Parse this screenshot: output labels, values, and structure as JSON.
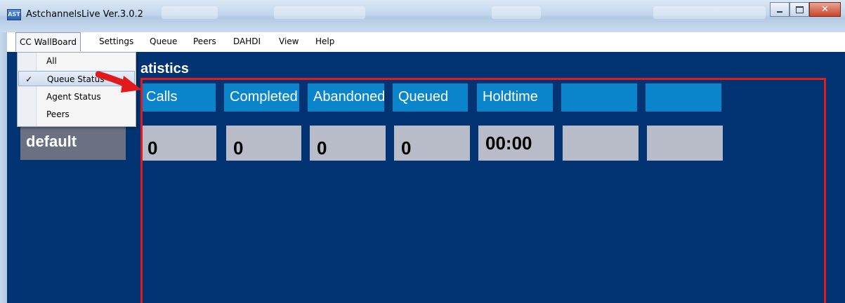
{
  "window": {
    "title": "AstchannelsLive Ver.3.0.2",
    "icon": "app-icon",
    "icon_text": "AST"
  },
  "menu": {
    "items": [
      "CC WallBoard",
      "Settings",
      "Queue",
      "Peers",
      "DAHDI",
      "View",
      "Help"
    ],
    "open_menu": "CC WallBoard",
    "dropdown": [
      {
        "label": "All",
        "checked": false
      },
      {
        "label": "Queue Status",
        "checked": true
      },
      {
        "label": "Agent Status",
        "checked": false
      },
      {
        "label": "Peers",
        "checked": false
      }
    ]
  },
  "main": {
    "title_visible": "atistics",
    "queue_name": "default",
    "headers": [
      "Calls",
      "Completed",
      "Abandoned",
      "Queued",
      "Holdtime",
      "",
      ""
    ],
    "values": [
      "0",
      "0",
      "0",
      "0",
      "00:00",
      "",
      ""
    ]
  },
  "colors": {
    "background": "#023473",
    "header": "#0a85cc",
    "value_box": "#b8bcc9",
    "highlight": "#e11b1b",
    "arrow": "#e11b1b"
  }
}
